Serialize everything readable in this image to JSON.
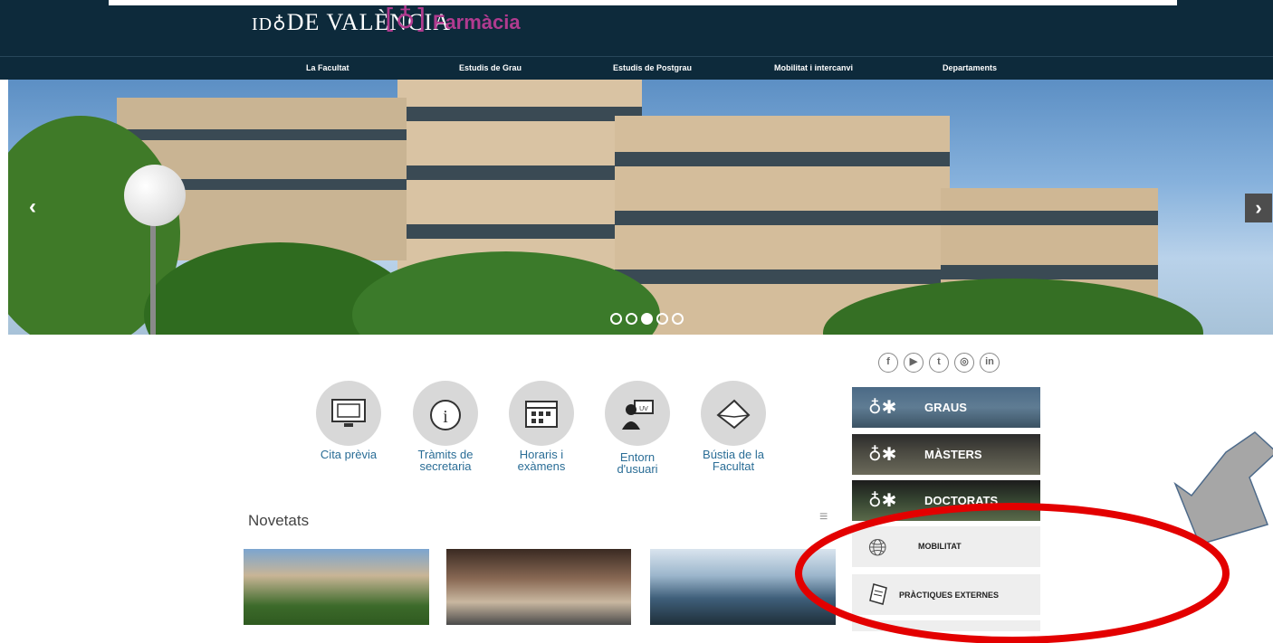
{
  "header": {
    "university_logo": "DE VALÈNCIA",
    "faculty_logo": "Farmàcia"
  },
  "nav": {
    "items": [
      "La Facultat",
      "Estudis de Grau",
      "Estudis de Postgrau",
      "Mobilitat i intercanvi",
      "Departaments"
    ]
  },
  "carousel": {
    "prev_icon": "chevron-left-icon",
    "next_icon": "chevron-right-icon",
    "slide_count": 5,
    "active_slide": 3
  },
  "quick_links": [
    {
      "label": "Cita prèvia",
      "icon": "calendar-monitor-icon"
    },
    {
      "label": "Tràmits de secretaria",
      "icon": "info-icon"
    },
    {
      "label": "Horaris i exàmens",
      "icon": "calendar-icon"
    },
    {
      "label": "Entorn d'usuari",
      "icon": "user-desk-icon"
    },
    {
      "label": "Bústia de la Facultat",
      "icon": "envelope-icon"
    }
  ],
  "social": [
    "facebook-icon",
    "youtube-icon",
    "twitter-icon",
    "instagram-icon",
    "linkedin-icon"
  ],
  "tiles": {
    "graus": "GRAUS",
    "masters": "MÀSTERS",
    "doctorats": "DOCTORATS",
    "mobilitat": "MOBILITAT",
    "practiques": "PRÀCTIQUES EXTERNES"
  },
  "novetats": {
    "title": "Novetats"
  },
  "colors": {
    "header_bg": "#0d2a3b",
    "faculty_accent": "#b03b8f",
    "link_blue": "#2a6d96",
    "annotation_red": "#e30000",
    "annotation_arrow": "#a6a6a6"
  }
}
